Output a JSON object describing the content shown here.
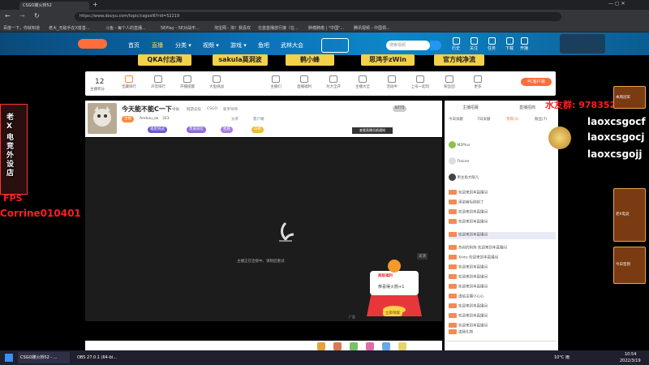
{
  "browser": {
    "tab_title": "CSGO媒火桥52",
    "url": "https://www.douyu.com/topic/csgoxl6?rid=52219",
    "bookmarks": [
      "百度一下，你就知道",
      "老大_无敌手在X首善...",
      "斗鱼 - 每个人的直播...",
      "5EPlay - 5E对战平...",
      "淘宝网 - 淘！我喜欢",
      "在首首播放行接（在...",
      "肿瘤肺癌 | \"中国\"...",
      "腾讯视频 - 中国领..."
    ]
  },
  "site": {
    "nav": [
      "首页",
      "直播",
      "分类 ▾",
      "视频 ▾",
      "游戏 ▾",
      "鱼吧",
      "武林大会"
    ],
    "search_placeholder": "搜索视频",
    "header_icons": [
      "历史",
      "关注",
      "任务",
      "下载",
      "开播",
      "我的",
      "创作中心"
    ]
  },
  "banners": [
    "QKA付志海",
    "sakula莫洞波",
    "鹤小蜂",
    "思鸿手zWin",
    "官方纯净流"
  ],
  "toolbar": {
    "rank_num": "12",
    "items": [
      "主播积分",
      "宝藏排行",
      "声音排行",
      "开播提醒",
      "大鱼挑战",
      "主播们",
      "直播福利",
      "为大全开",
      "主播大全",
      "活动中",
      "上号一起玩",
      "粉丝团",
      "更多"
    ],
    "pc_button": "PC客户端"
  },
  "room": {
    "title": "今天能不能C一下",
    "tags": [
      "举报",
      "网游竞技",
      "CSGO",
      "新手导师"
    ],
    "level_pill": "主播",
    "host_name": "Amhou_ok",
    "fans": "323",
    "extra": [
      "分享",
      "客户端"
    ],
    "pills": [
      "福星挑战",
      "贵族排位",
      "星愿",
      "白银"
    ],
    "follow_count": "8775",
    "report_btn": "查看直播兑换通知"
  },
  "player": {
    "loading_text": "主播正在连接中，请稍后重试",
    "badge_text": "高清",
    "promo_title": "超级福利",
    "promo_body": "恭喜得火箭+1",
    "promo_btn": "立即领取",
    "ad_label": "广告"
  },
  "chat": {
    "tabs": [
      "主播招募",
      "直播招商",
      "粉丝团"
    ],
    "subtabs": [
      "今日贡献",
      "7日贡献",
      "贵宾(1)",
      "粉丝(7)"
    ],
    "ranks": [
      "M2Plus",
      "Fleiner",
      "男主角大眼儿"
    ],
    "lines": [
      "欢迎来到本直播间",
      "演讲者标刷新了",
      "欢迎来到本直播间",
      "欢迎来到本直播间",
      "欢迎来到本直播间",
      "热闹的狗狗 欢迎来到本直播间",
      "Xinto 欢迎来到本直播间",
      "欢迎来到本直播间",
      "欢迎来到本直播间",
      "欢迎来到本直播间",
      "送给主播小心心",
      "欢迎来到本直播间",
      "欢迎来到本直播间",
      "欢迎来到本直播间",
      "送我礼物"
    ]
  },
  "overlay": {
    "left_badge_lines": [
      "老",
      "X",
      "电",
      "竞",
      "外",
      "设",
      "店"
    ],
    "fps_text": "FPS",
    "left_name": "Corrine010401",
    "qq_group": "水友群: 97835201",
    "right_ids": [
      "laoxcsgocf",
      "laoxcsgocj",
      "laoxcsgojj"
    ],
    "right_ads": [
      "本周冠军",
      "老X电竞",
      "今日签到"
    ]
  },
  "taskbar": {
    "apps": [
      "CSGO媒火桥52 - ...",
      "OBS 27.0.1 (64-bi..."
    ],
    "weather": "10°C 雨",
    "time": "10:54",
    "date": "2022/3/19"
  }
}
